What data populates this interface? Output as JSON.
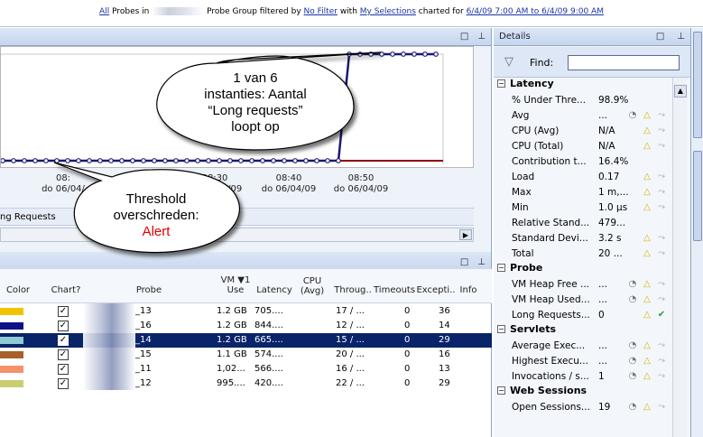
{
  "topbar": {
    "all_probes": "All",
    "probes_in": "Probes in",
    "probe_group_text": "Probe Group filtered by",
    "no_filter": "No Filter",
    "with_text": "with",
    "my_selections": "My Selections",
    "charted_for": "charted for",
    "time_range": "6/4/09 7:00 AM to 6/4/09 9:00 AM"
  },
  "chart_panel": {
    "restore_icon": "□",
    "pin_icon": "⊥"
  },
  "chart_data": {
    "type": "line",
    "x": [
      "08:10",
      "08:20",
      "08:30",
      "08:40",
      "08:50"
    ],
    "tick_labels": [
      {
        "time": "08:",
        "date": "do 06/04/"
      },
      {
        "time": "8:20",
        "date": "09"
      },
      {
        "time": "08:30",
        "date": "do 06/04/09"
      },
      {
        "time": "08:40",
        "date": "do 06/04/09"
      },
      {
        "time": "08:50",
        "date": "do 06/04/09"
      }
    ],
    "series": [
      {
        "color": "#1a1a6e",
        "description": "spike",
        "values_norm": [
          0,
          0,
          0,
          0,
          0,
          0,
          0,
          0,
          0,
          0,
          0,
          0,
          0,
          0,
          0,
          0,
          0,
          0,
          0,
          0,
          0,
          0,
          0,
          0,
          0,
          0,
          0,
          0,
          0,
          0,
          0,
          0,
          1,
          1,
          1,
          1,
          1,
          1,
          1,
          1,
          1
        ]
      }
    ],
    "threshold_color": "#8b0000"
  },
  "legend_strip": {
    "label": "ng Requests"
  },
  "table": {
    "restore_icon": "□",
    "pin_icon": "⊥",
    "columns": {
      "color": "Color",
      "chart": "Chart?",
      "probe": "Probe",
      "vm_use": "VM ▼1 Use",
      "latency": "Latency",
      "cpu_avg": "CPU (Avg)",
      "throughput": "Throug..",
      "timeouts": "Timeouts",
      "exceptions": "Excepti..",
      "info": "Info"
    },
    "rows": [
      {
        "color": "#f2c400",
        "checked": "☑",
        "probe": "_13",
        "vm": "1.2 GB",
        "latency": "705....",
        "throughput": "17 / ...",
        "timeouts": "0",
        "exceptions": "36",
        "selected": false
      },
      {
        "color": "#10108a",
        "checked": "☑",
        "probe": "_16",
        "vm": "1.2 GB",
        "latency": "844....",
        "throughput": "12 / ...",
        "timeouts": "0",
        "exceptions": "14",
        "selected": false
      },
      {
        "color": "#8ecbd4",
        "checked": "☑",
        "probe": "_14",
        "vm": "1.2 GB",
        "latency": "665....",
        "throughput": "15 / ...",
        "timeouts": "0",
        "exceptions": "29",
        "selected": true
      },
      {
        "color": "#a8612a",
        "checked": "☑",
        "probe": "_15",
        "vm": "1.1 GB",
        "latency": "574....",
        "throughput": "20 / ...",
        "timeouts": "0",
        "exceptions": "16",
        "selected": false
      },
      {
        "color": "#f4916a",
        "checked": "☑",
        "probe": "_11",
        "vm": "1,02...",
        "latency": "566....",
        "throughput": "16 / ...",
        "timeouts": "0",
        "exceptions": "13",
        "selected": false
      },
      {
        "color": "#c9cf70",
        "checked": "☑",
        "probe": "_12",
        "vm": "995....",
        "latency": "420....",
        "throughput": "22 / ...",
        "timeouts": "0",
        "exceptions": "29",
        "selected": false
      }
    ]
  },
  "details": {
    "title": "Details",
    "restore_icon": "□",
    "pin_icon": "⊥",
    "find_label": "Find:",
    "find_value": "",
    "latency_header": "Latency",
    "latency_rows": [
      {
        "k": "% Under Thre...",
        "v": "98.9%",
        "icons": ""
      },
      {
        "k": "Avg",
        "v": "...",
        "icons": "gauge"
      },
      {
        "k": "CPU (Avg)",
        "v": "N/A",
        "icons": "warn"
      },
      {
        "k": "CPU (Total)",
        "v": "N/A",
        "icons": "warn"
      },
      {
        "k": "Contribution t...",
        "v": "16.4%",
        "icons": ""
      },
      {
        "k": "Load",
        "v": "0.17",
        "icons": "warn"
      },
      {
        "k": "Max",
        "v": "1 m,...",
        "icons": "warn"
      },
      {
        "k": "Min",
        "v": "1.0 µs",
        "icons": "warn"
      },
      {
        "k": "Relative Stand...",
        "v": "479...",
        "icons": ""
      },
      {
        "k": "Standard Devi...",
        "v": "3.2 s",
        "icons": "warn"
      },
      {
        "k": "Total",
        "v": "20 ...",
        "icons": "warn"
      }
    ],
    "probe_header": "Probe",
    "probe_rows": [
      {
        "k": "VM Heap Free ...",
        "v": "...",
        "icons": "gauge"
      },
      {
        "k": "VM Heap Used...",
        "v": "...",
        "icons": "gauge"
      },
      {
        "k": "Long Requests...",
        "v": "0",
        "icons": "check"
      }
    ],
    "servlets_header": "Servlets",
    "servlet_rows": [
      {
        "k": "Average Exec...",
        "v": "...",
        "icons": "gauge"
      },
      {
        "k": "Highest Execu...",
        "v": "...",
        "icons": "gauge"
      },
      {
        "k": "Invocations / s...",
        "v": "1",
        "icons": "gauge"
      }
    ],
    "websessions_header": "Web Sessions",
    "websession_rows": [
      {
        "k": "Open Sessions...",
        "v": "19",
        "icons": "gauge"
      }
    ]
  },
  "callouts": {
    "top": {
      "line1": "1 van 6",
      "line2": "instanties: Aantal",
      "line3": "“Long requests”",
      "line4": "loopt op"
    },
    "threshold": {
      "line1": "Threshold",
      "line2": "overschreden:",
      "line3": "Alert"
    }
  }
}
